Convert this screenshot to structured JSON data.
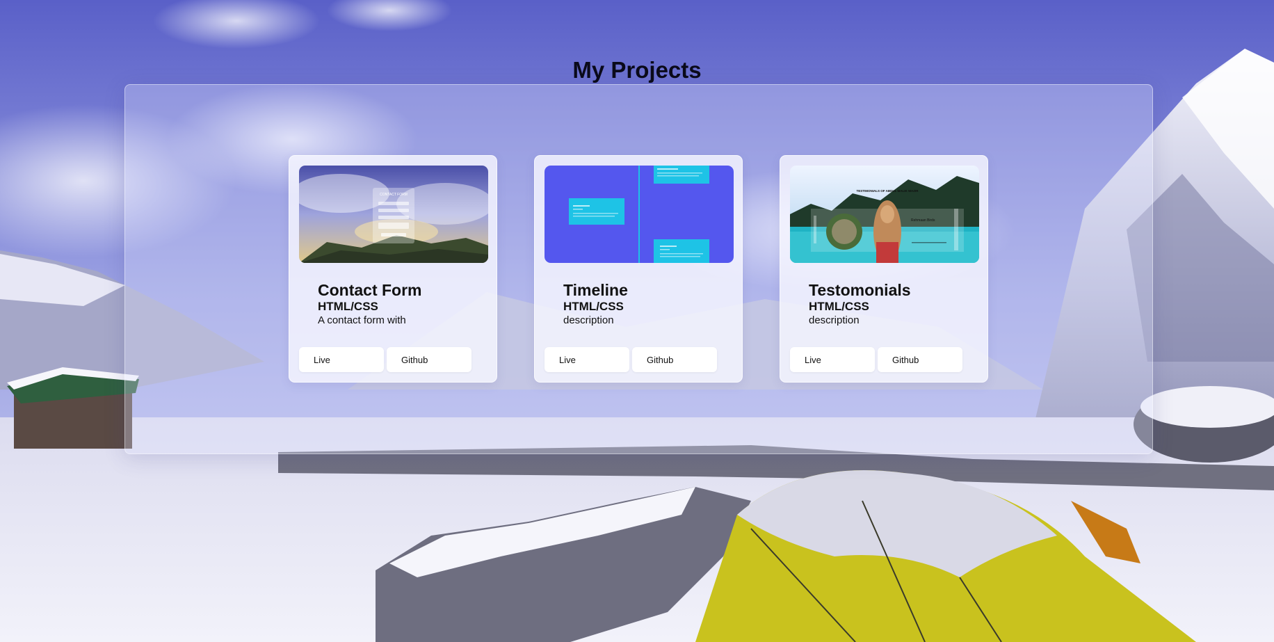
{
  "page": {
    "title": "My Projects"
  },
  "colors": {
    "sky": "#6a6fd0",
    "snow": "#e9e9f6",
    "tent_yellow": "#c9c21e",
    "timeline_blue": "#5457ee",
    "timeline_cyan": "#1ec3e6",
    "card_bg": "#f4f4fc"
  },
  "projects": [
    {
      "title": "Contact Form",
      "tech": "HTML/CSS",
      "description": "A contact form with",
      "thumbnail": "contact-form-preview",
      "thumbnail_text": "CONTACT FORM",
      "live_label": "Live",
      "github_label": "Github"
    },
    {
      "title": "Timeline",
      "tech": "HTML/CSS",
      "description": "description",
      "thumbnail": "timeline-preview",
      "live_label": "Live",
      "github_label": "Github"
    },
    {
      "title": "Testomonials",
      "tech": "HTML/CSS",
      "description": "description",
      "thumbnail": "testimonials-preview",
      "thumbnail_text": "TESTIMONIALS OF ABDUL MALIK WAZIR",
      "thumbnail_name": "Rehmaan Birds",
      "live_label": "Live",
      "github_label": "Github"
    }
  ]
}
